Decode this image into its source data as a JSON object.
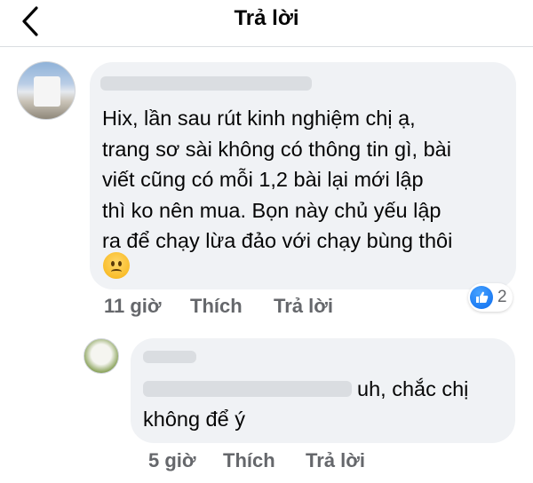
{
  "header": {
    "title": "Trả lời"
  },
  "comments": [
    {
      "text": "Hix, lần sau rút kinh nghiệm chị ạ,\ntrang sơ sài không có thông tin gì, bài\nviết cũng có mỗi 1,2 bài lại mới lập\nthì ko nên mua. Bọn này chủ yếu lập\nra để chạy lừa đảo với chạy bùng thôi",
      "emoji": "frowning-face",
      "time": "11 giờ",
      "like_label": "Thích",
      "reply_label": "Trả lời",
      "reactions": {
        "type": "like",
        "count": "2"
      }
    },
    {
      "text_line1": "uh, chắc chị",
      "text_line2": "không để ý",
      "time": "5 giờ",
      "like_label": "Thích",
      "reply_label": "Trả lời"
    }
  ],
  "colors": {
    "bubble": "#f0f2f5",
    "meta_text": "#65676b",
    "like_blue": "#1877f2"
  }
}
